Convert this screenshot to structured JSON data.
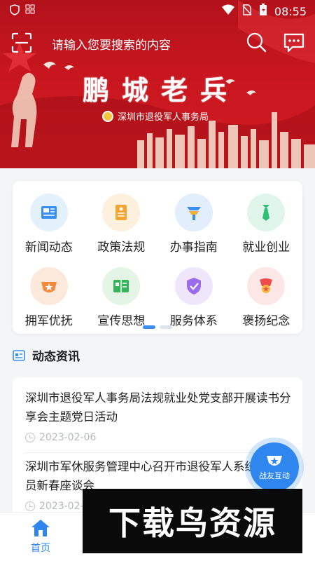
{
  "status_bar": {
    "time": "08:55"
  },
  "header": {
    "search_placeholder": "请输入您要搜索的内容",
    "banner_title": "鹏城老兵",
    "banner_subtitle": "深圳市退役军人事务局"
  },
  "menu": {
    "items": [
      {
        "label": "新闻动态",
        "icon": "newspaper-icon",
        "bg": "#e3f1fd",
        "fg": "#3a8ef0"
      },
      {
        "label": "政策法规",
        "icon": "document-icon",
        "bg": "#fdf0dc",
        "fg": "#f2a531"
      },
      {
        "label": "办事指南",
        "icon": "guide-icon",
        "bg": "#e3eefc",
        "fg": "#3a8ef0"
      },
      {
        "label": "就业创业",
        "icon": "tie-icon",
        "bg": "#e1f6ea",
        "fg": "#2fbf74"
      },
      {
        "label": "拥军优抚",
        "icon": "badge-icon",
        "bg": "#fde9dc",
        "fg": "#f28a3c"
      },
      {
        "label": "宣传思想",
        "icon": "book-icon",
        "bg": "#e3f5e5",
        "fg": "#38b35a"
      },
      {
        "label": "服务体系",
        "icon": "shield-icon",
        "bg": "#efe6fb",
        "fg": "#9b6bf0"
      },
      {
        "label": "褒扬纪念",
        "icon": "medal-icon",
        "bg": "#fde6e6",
        "fg": "#ee4b4b"
      }
    ]
  },
  "news_section": {
    "title": "动态资讯"
  },
  "news": [
    {
      "title": "深圳市退役军人事务局法规就业处党支部开展读书分享会主题党日活动",
      "date": "2023-02-06"
    },
    {
      "title": "深圳市军休服务管理中心召开市退役军人系统退休人员新春座谈会",
      "date": "2023-02-..."
    }
  ],
  "float_button": {
    "label": "战友互动"
  },
  "tabbar": {
    "home_label": "首页"
  },
  "watermark": {
    "text": "下载鸟资源"
  },
  "colors": {
    "primary": "#2f86ee",
    "banner_red": "#c8161f"
  }
}
